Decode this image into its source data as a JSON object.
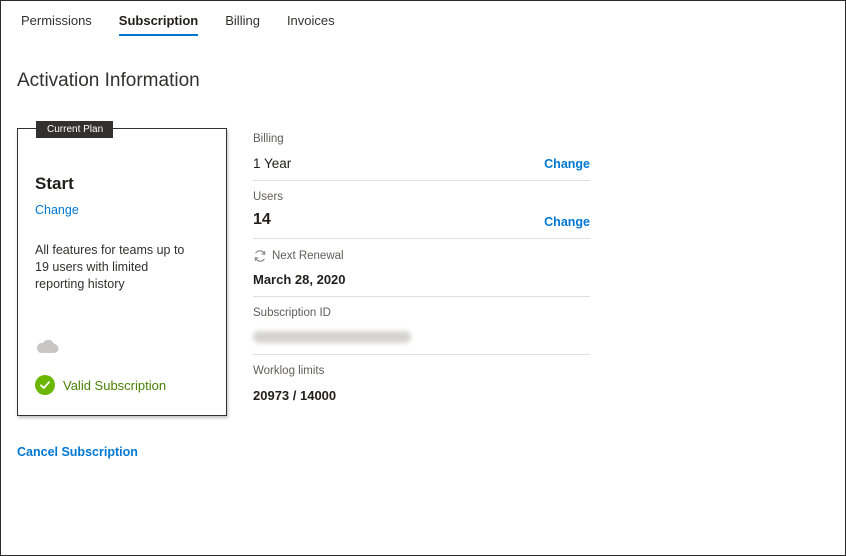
{
  "tabs": [
    {
      "label": "Permissions"
    },
    {
      "label": "Subscription",
      "active": true
    },
    {
      "label": "Billing"
    },
    {
      "label": "Invoices"
    }
  ],
  "page_title": "Activation Information",
  "plan_card": {
    "badge": "Current Plan",
    "plan_name": "Start",
    "change_label": "Change",
    "description": "All features for teams up to 19 users with limited reporting history",
    "cloud_icon": "cloud-icon",
    "status_icon": "check-circle-icon",
    "status_text": "Valid Subscription",
    "status_color": "#6bb700"
  },
  "details": {
    "billing": {
      "label": "Billing",
      "value": "1 Year",
      "change_label": "Change"
    },
    "users": {
      "label": "Users",
      "value": "14",
      "change_label": "Change"
    },
    "renewal": {
      "label": "Next Renewal",
      "value": "March 28, 2020",
      "icon": "refresh-icon"
    },
    "subscription_id": {
      "label": "Subscription ID"
    },
    "worklog": {
      "label": "Worklog limits",
      "value": "20973 / 14000"
    }
  },
  "cancel_label": "Cancel Subscription",
  "colors": {
    "accent": "#0078d4",
    "text": "#323130",
    "success": "#498205"
  }
}
